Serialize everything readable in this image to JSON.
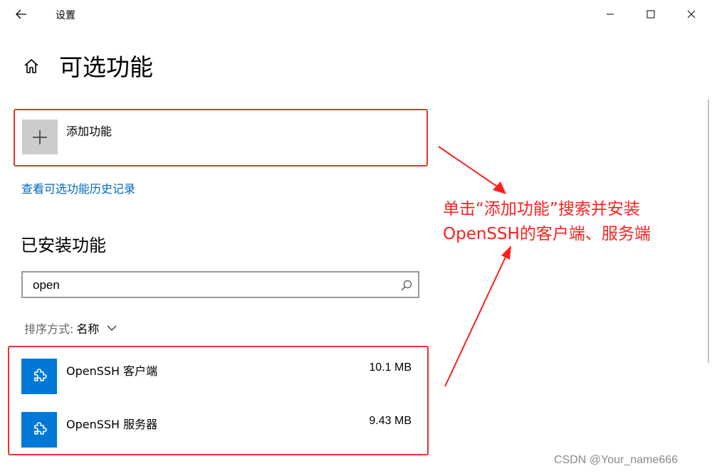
{
  "window": {
    "app_title": "设置"
  },
  "page": {
    "title": "可选功能"
  },
  "add_feature": {
    "label": "添加功能"
  },
  "history_link": "查看可选功能历史记录",
  "installed": {
    "section_title": "已安装功能",
    "search": {
      "value": "open",
      "placeholder": ""
    },
    "sort": {
      "label": "排序方式:",
      "value": "名称"
    },
    "features": [
      {
        "name": "OpenSSH 客户端",
        "size": "10.1 MB",
        "icon": "puzzle-piece-icon"
      },
      {
        "name": "OpenSSH 服务器",
        "size": "9.43 MB",
        "icon": "puzzle-piece-icon"
      }
    ]
  },
  "annotation": {
    "line1": "单击“添加功能”搜索并安装",
    "line2": "OpenSSH的客户端、服务端"
  },
  "watermark": "CSDN @Your_name666",
  "colors": {
    "accent": "#0078d7",
    "link": "#0067b8",
    "annotation_red": "#ff1f1f",
    "tile_gray": "#cccccc"
  }
}
